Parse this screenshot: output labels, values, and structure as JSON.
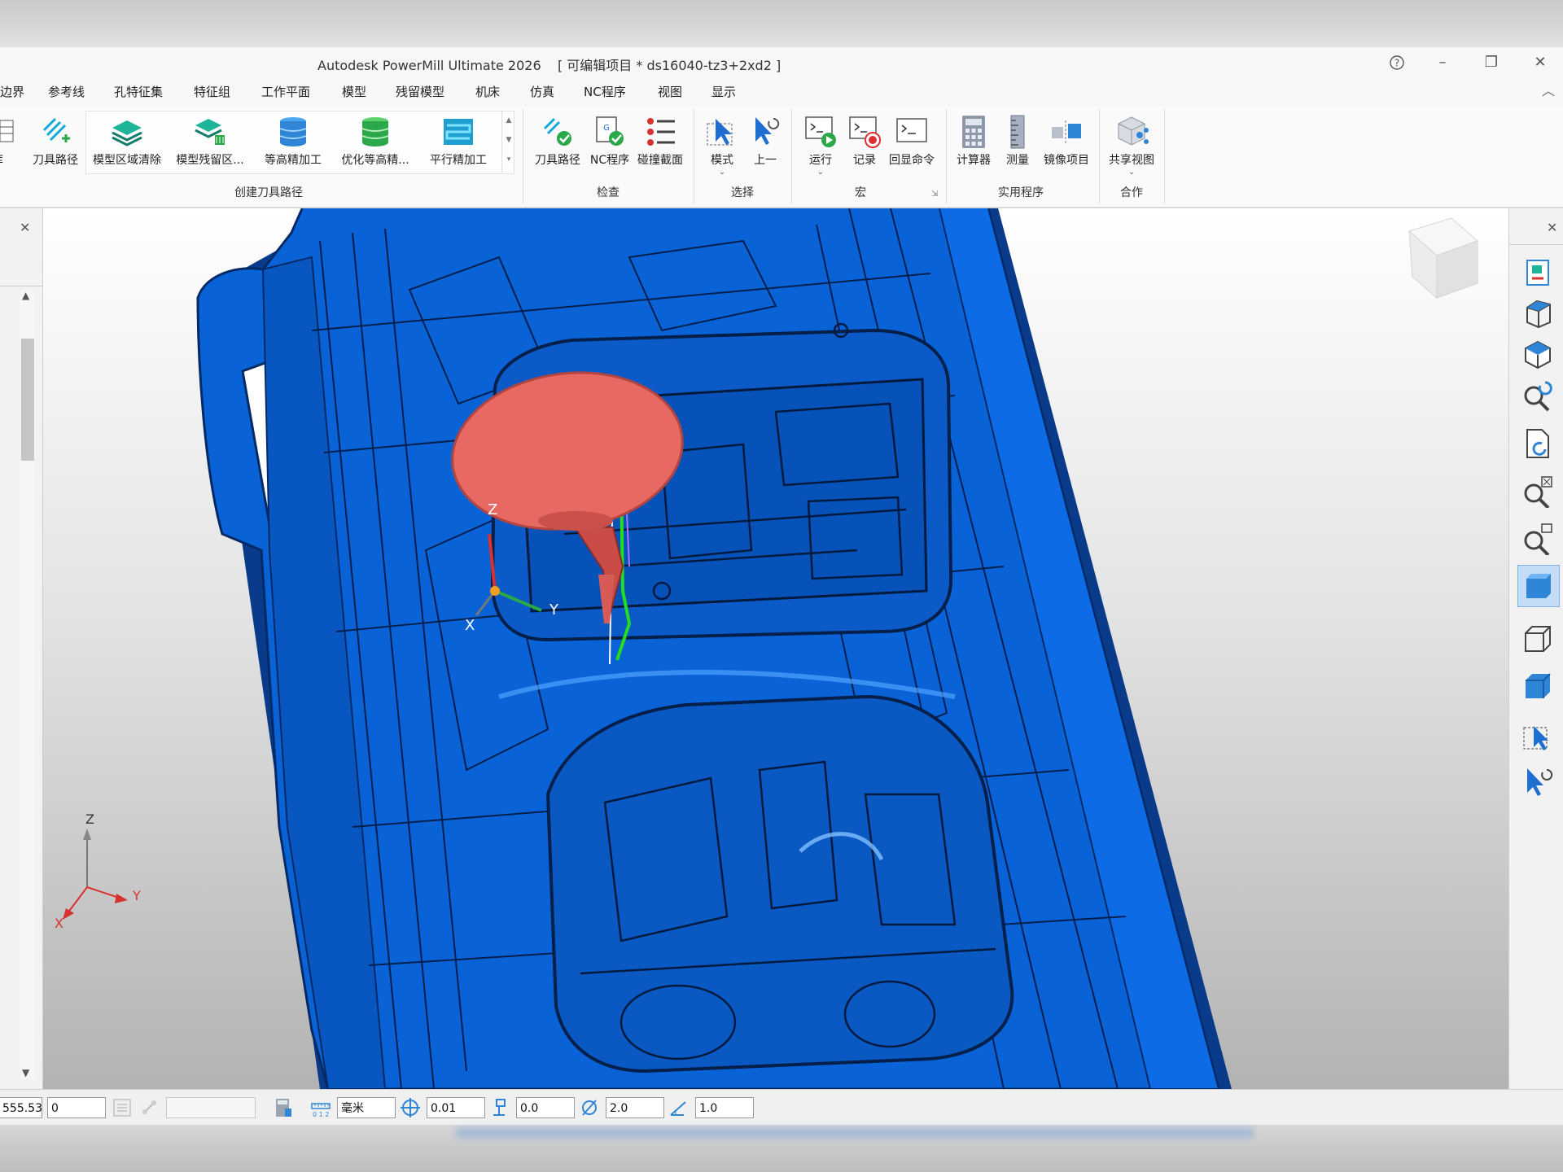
{
  "app_title": "Autodesk PowerMill Ultimate 2026",
  "project": "[ 可编辑项目 * ds16040-tz3+2xd2 ]",
  "window_controls": {
    "help": "?",
    "minimize": "–",
    "restore": "❐",
    "close": "✕"
  },
  "menu": [
    "边界",
    "参考线",
    "孔特征集",
    "特征组",
    "工作平面",
    "模型",
    "残留模型",
    "机床",
    "仿真",
    "NC程序",
    "视图",
    "显示"
  ],
  "ribbon": {
    "partial_button": "库",
    "create_toolpath": {
      "label": "创建刀具路径",
      "toolpath_button": "刀具路径",
      "gallery": [
        "模型区域清除",
        "模型残留区...",
        "等高精加工",
        "优化等高精...",
        "平行精加工"
      ]
    },
    "check": {
      "label": "检查",
      "buttons": [
        "刀具路径",
        "NC程序",
        "碰撞截面"
      ]
    },
    "select": {
      "label": "选择",
      "buttons": [
        "模式",
        "上一"
      ]
    },
    "macro": {
      "label": "宏",
      "buttons": [
        "运行",
        "记录",
        "回显命令"
      ]
    },
    "utilities": {
      "label": "实用程序",
      "buttons": [
        "计算器",
        "测量",
        "镜像项目"
      ]
    },
    "collab": {
      "label": "合作",
      "buttons": [
        "共享视图"
      ]
    }
  },
  "viewport": {
    "axis_labels": {
      "x": "X",
      "y": "Y",
      "z": "Z"
    },
    "triad_labels": {
      "x": "X",
      "y": "Y",
      "z": "Z"
    },
    "colors": {
      "model": "#0a63d6",
      "tool_holder": "#e86862",
      "background_top": "#ffffff",
      "background_bottom": "#b3b3b3"
    }
  },
  "right_tools": [
    "model-view-icon",
    "iso-view-icon",
    "top-view-icon",
    "zoom-undo-icon",
    "refresh-icon",
    "zoom-fit-icon",
    "zoom-box-icon",
    "shaded-icon",
    "wireframe-icon",
    "plain-shaded-icon",
    "select-icon",
    "select-undo-icon"
  ],
  "status": {
    "coord": "555.53",
    "value": "0",
    "units": "毫米",
    "tolerance": "0.01",
    "thickness": "0.0",
    "diameter": "2.0",
    "stepover": "1.0"
  }
}
